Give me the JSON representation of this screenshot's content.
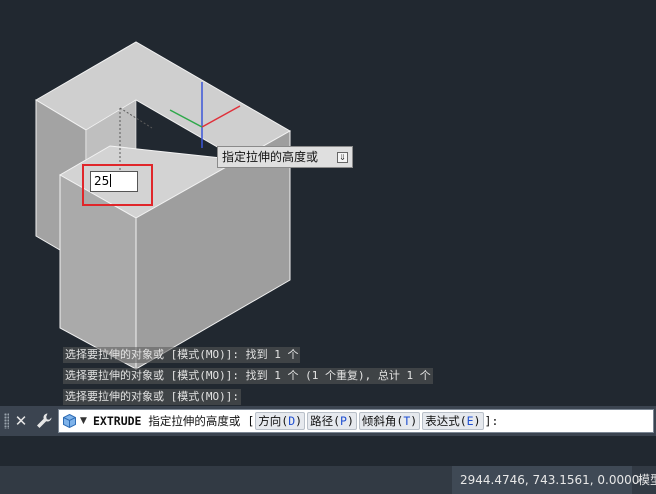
{
  "tooltip": {
    "prompt": "指定拉伸的高度或"
  },
  "dynamic_input": {
    "value": "25"
  },
  "history": [
    "选择要拉伸的对象或 [模式(MO)]: 找到 1 个",
    "选择要拉伸的对象或 [模式(MO)]: 找到 1 个 (1 个重复), 总计 1 个",
    "选择要拉伸的对象或 [模式(MO)]:"
  ],
  "command": {
    "name": "EXTRUDE",
    "prompt": "指定拉伸的高度或",
    "open": "[",
    "close": "]:",
    "options": [
      {
        "label": "方向(",
        "key": "D",
        "end": ")"
      },
      {
        "label": "路径(",
        "key": "P",
        "end": ")"
      },
      {
        "label": "倾斜角(",
        "key": "T",
        "end": ")"
      },
      {
        "label": "表达式(",
        "key": "E",
        "end": ")"
      }
    ]
  },
  "status": {
    "coordinates": "2944.4746, 743.1561, 0.0000",
    "model_tab": "模型"
  },
  "colors": {
    "background": "#212830",
    "highlight_box": "#e0262a",
    "option_key": "#1f4fd1"
  },
  "icons": {
    "close": "close-icon",
    "customize": "wrench-icon",
    "command_history": "cube-icon",
    "dropdown": "chevron-down-icon",
    "tooltip_options": "download-arrow-icon"
  }
}
